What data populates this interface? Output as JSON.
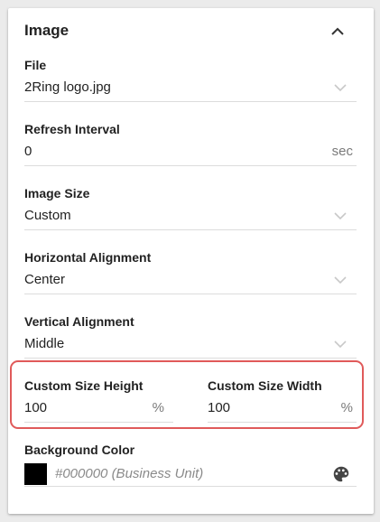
{
  "section": {
    "title": "Image"
  },
  "fields": {
    "file": {
      "label": "File",
      "value": "2Ring logo.jpg"
    },
    "refresh": {
      "label": "Refresh Interval",
      "value": "0",
      "unit": "sec"
    },
    "image_size": {
      "label": "Image Size",
      "value": "Custom"
    },
    "horizontal": {
      "label": "Horizontal Alignment",
      "value": "Center"
    },
    "vertical": {
      "label": "Vertical Alignment",
      "value": "Middle"
    },
    "custom_height": {
      "label": "Custom Size Height",
      "value": "100",
      "unit": "%"
    },
    "custom_width": {
      "label": "Custom Size Width",
      "value": "100",
      "unit": "%"
    },
    "background": {
      "label": "Background Color",
      "value": "#000000 (Business Unit)",
      "swatch_color": "#000000"
    }
  },
  "icons": {
    "collapse": "chevron-up-icon",
    "dropdown": "chevron-down-icon",
    "palette": "palette-icon"
  },
  "colors": {
    "highlight": "#e05a5a"
  }
}
